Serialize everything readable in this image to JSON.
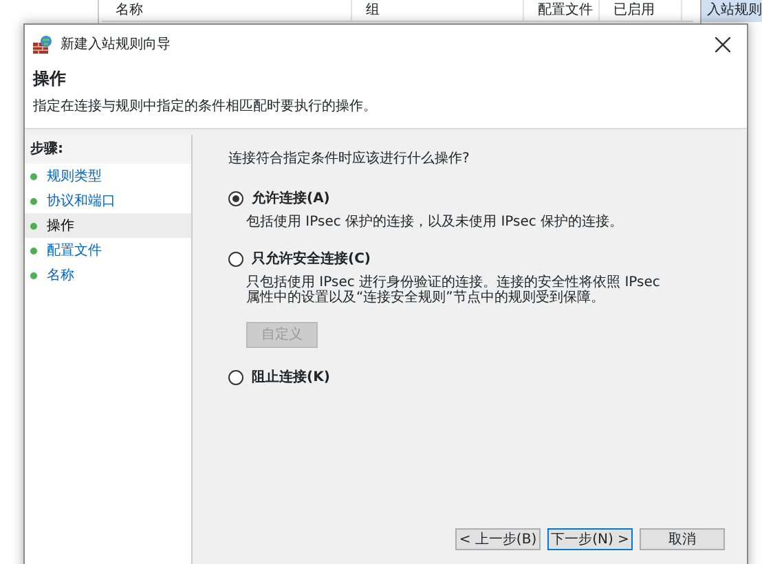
{
  "background": {
    "columns": [
      "名称",
      "组",
      "配置文件",
      "已启用"
    ],
    "actions_title": "入站规则"
  },
  "dialog": {
    "title": "新建入站规则向导",
    "heading": "操作",
    "subtitle": "指定在连接与规则中指定的条件相匹配时要执行的操作。",
    "steps_label": "步骤:",
    "steps": [
      {
        "label": "规则类型",
        "selected": false
      },
      {
        "label": "协议和端口",
        "selected": false
      },
      {
        "label": "操作",
        "selected": true
      },
      {
        "label": "配置文件",
        "selected": false
      },
      {
        "label": "名称",
        "selected": false
      }
    ],
    "question": "连接符合指定条件时应该进行什么操作?",
    "options": [
      {
        "label": "允许连接(A)",
        "selected": true,
        "description": "包括使用 IPsec 保护的连接，以及未使用 IPsec 保护的连接。"
      },
      {
        "label": "只允许安全连接(C)",
        "selected": false,
        "description": "只包括使用 IPsec 进行身份验证的连接。连接的安全性将依照 IPsec 属性中的设置以及“连接安全规则”节点中的规则受到保障。",
        "button": {
          "label": "自定义",
          "disabled": true
        }
      },
      {
        "label": "阻止连接(K)",
        "selected": false
      }
    ],
    "buttons": [
      {
        "label": "< 上一步(B)",
        "default": false
      },
      {
        "label": "下一步(N) >",
        "default": true
      },
      {
        "label": "取消",
        "default": false
      }
    ]
  }
}
